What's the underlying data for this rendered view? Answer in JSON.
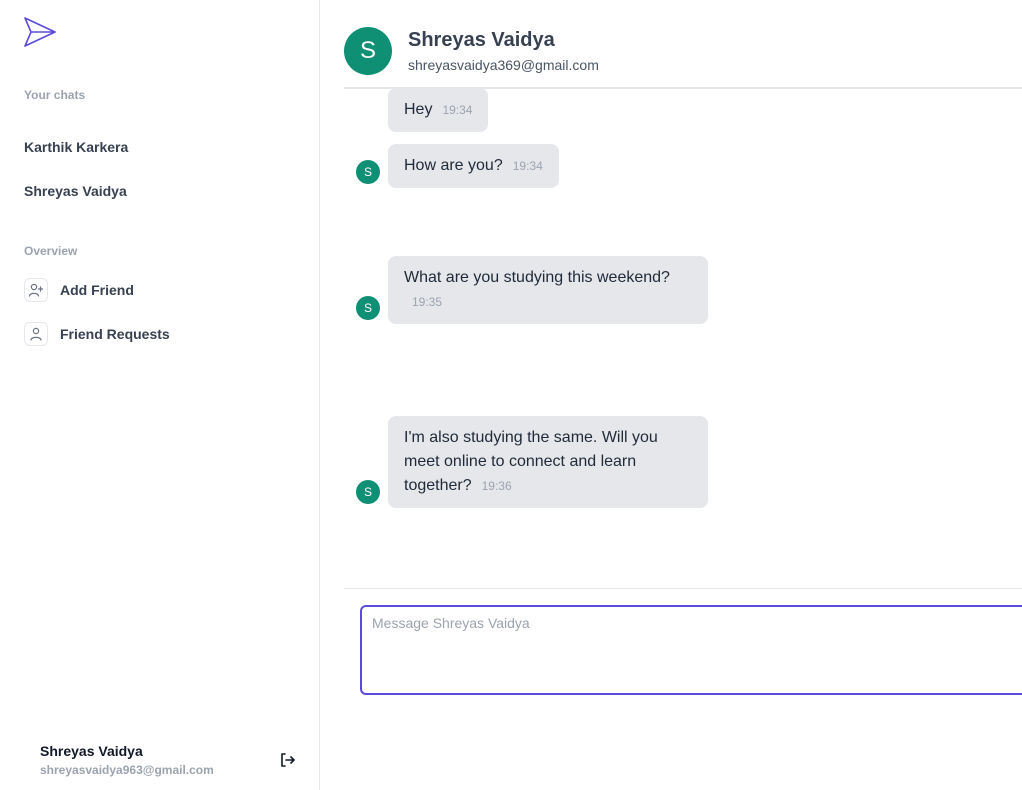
{
  "sidebar": {
    "chats_label": "Your chats",
    "chats": [
      {
        "name": "Karthik Karkera"
      },
      {
        "name": "Shreyas Vaidya"
      }
    ],
    "overview_label": "Overview",
    "nav": [
      {
        "label": "Add Friend",
        "icon": "user-plus-icon"
      },
      {
        "label": "Friend Requests",
        "icon": "user-icon"
      }
    ],
    "profile": {
      "name": "Shreyas Vaidya",
      "email": "shreyasvaidya963@gmail.com"
    }
  },
  "chat": {
    "partner": {
      "initial": "S",
      "name": "Shreyas Vaidya",
      "email": "shreyasvaidya369@gmail.com"
    },
    "messages": [
      {
        "text": "Hey",
        "time": "19:34"
      },
      {
        "text": "How are you?",
        "time": "19:34"
      },
      {
        "text": "What are you studying this weekend?",
        "time": "19:35"
      },
      {
        "text": "I'm also studying the same. Will you meet online to connect and learn together?",
        "time": "19:36"
      }
    ],
    "composer_placeholder": "Message Shreyas Vaidya"
  },
  "colors": {
    "accent": "#5b4bd8",
    "avatar": "#0f8f74",
    "bubble": "#e5e7eb"
  }
}
